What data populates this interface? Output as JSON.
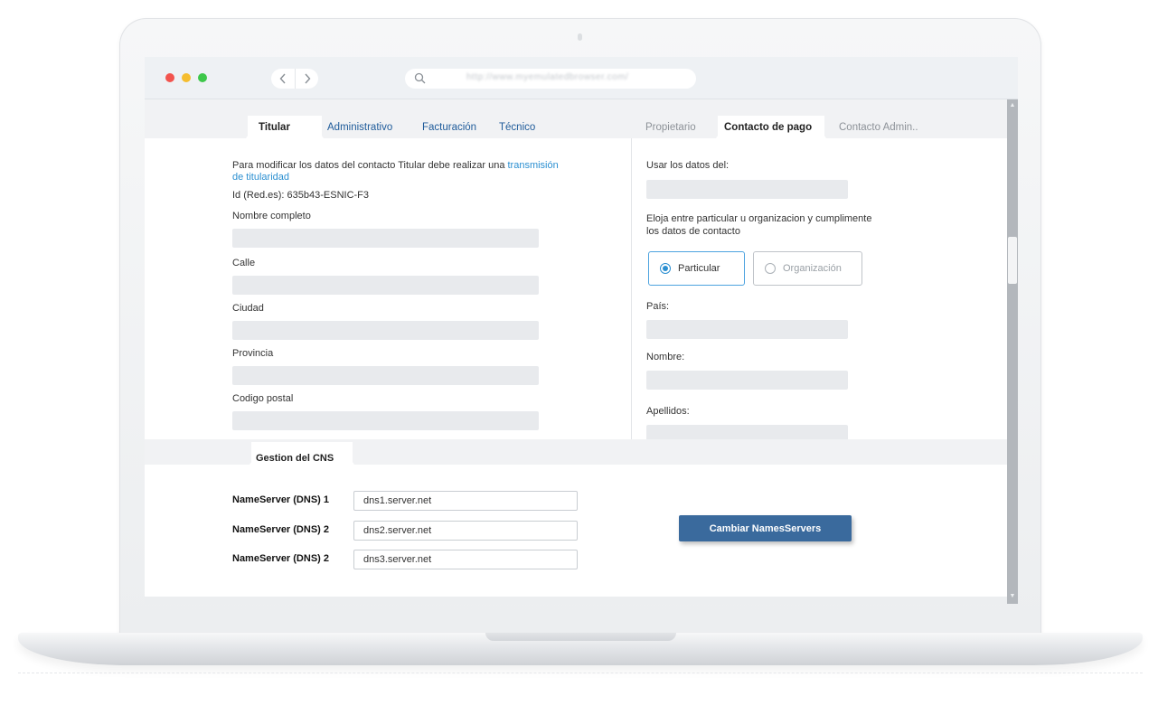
{
  "browser": {
    "back_icon": "chevron-left-icon",
    "forward_icon": "chevron-right-icon",
    "address": "http://www.myemulatedbrowser.com/"
  },
  "left_tabs": [
    {
      "label": "Titular",
      "active": true
    },
    {
      "label": "Administrativo",
      "active": false
    },
    {
      "label": "Facturación",
      "active": false
    },
    {
      "label": "Técnico",
      "active": false
    }
  ],
  "right_tabs": [
    {
      "label": "Propietario",
      "active": false
    },
    {
      "label": "Contacto de pago",
      "active": true
    },
    {
      "label": "Contacto Admin..",
      "active": false
    }
  ],
  "titular": {
    "notice": "Para modificar los datos del contacto Titular debe realizar una ",
    "notice_link_1": "transmisión",
    "notice_link_2": "de titularidad",
    "id_line": "Id (Red.es): 635b43-ESNIC-F3",
    "fields": [
      {
        "label": "Nombre completo",
        "value": ""
      },
      {
        "label": "Calle",
        "value": ""
      },
      {
        "label": "Ciudad",
        "value": ""
      },
      {
        "label": "Provincia",
        "value": ""
      },
      {
        "label": "Codigo postal",
        "value": ""
      }
    ]
  },
  "payment_contact": {
    "use_data_label": "Usar los datos del:",
    "choose_line_1": "Eloja entre particular u organizacion y cumplimente",
    "choose_line_2": "los datos de contacto",
    "options": [
      {
        "label": "Particular",
        "selected": true
      },
      {
        "label": "Organización",
        "selected": false
      }
    ],
    "fields": [
      {
        "label": "País:",
        "value": ""
      },
      {
        "label": "Nombre:",
        "value": ""
      },
      {
        "label": "Apellidos:",
        "value": ""
      }
    ]
  },
  "dns": {
    "section_title": "Gestion del CNS",
    "nameservers": [
      {
        "label": "NameServer (DNS) 1",
        "value": "dns1.server.net"
      },
      {
        "label": "NameServer (DNS) 2",
        "value": "dns2.server.net"
      },
      {
        "label": "NameServer (DNS) 2",
        "value": "dns3.server.net"
      }
    ],
    "submit_label": "Cambiar NamesServers"
  },
  "colors": {
    "link": "#2b8fd1",
    "tab": "#1e5b9a",
    "primary_button": "#3a6a9d",
    "field_bg": "#e8eaed"
  }
}
